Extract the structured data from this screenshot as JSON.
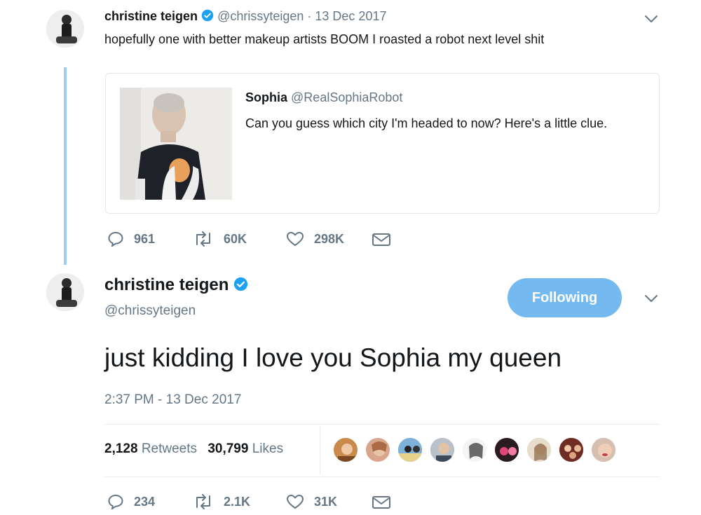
{
  "tweet1": {
    "name": "christine teigen",
    "handle": "@chrissyteigen",
    "date": "· 13 Dec 2017",
    "text": "hopefully one with better makeup artists BOOM I roasted a robot next level shit",
    "quote": {
      "name": "Sophia",
      "handle": "@RealSophiaRobot",
      "text": "Can you guess which city I'm headed to now? Here's a little clue."
    },
    "actions": {
      "replies": "961",
      "retweets": "60K",
      "likes": "298K"
    }
  },
  "tweet2": {
    "name": "christine teigen",
    "handle": "@chrissyteigen",
    "follow_label": "Following",
    "text": "just kidding I love you Sophia my queen",
    "timestamp": "2:37 PM - 13 Dec 2017",
    "stats": {
      "retweets_count": "2,128",
      "retweets_label": "Retweets",
      "likes_count": "30,799",
      "likes_label": "Likes"
    },
    "actions": {
      "replies": "234",
      "retweets": "2.1K",
      "likes": "31K"
    }
  },
  "colors": {
    "brand_blue": "#1da1f2",
    "follow_button": "#74b9f0",
    "thread_line": "#9ecff2",
    "muted_text": "#657786"
  }
}
